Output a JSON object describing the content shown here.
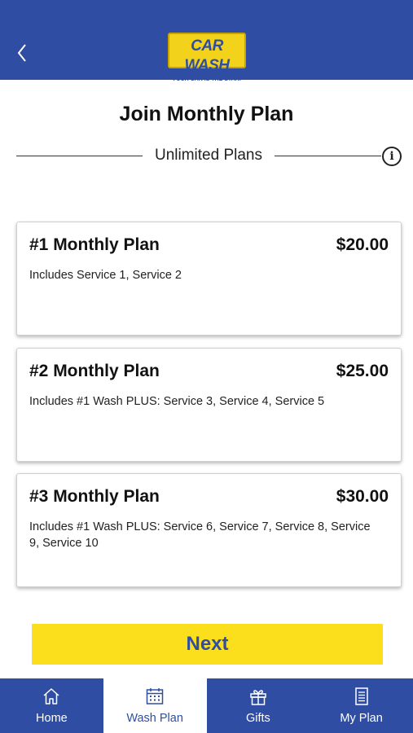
{
  "header": {
    "back_icon": "chevron-left-icon",
    "logo_text": "CAR WASH",
    "logo_tagline": "YOUR CAR IS THE STAR!",
    "bar_color": "#2f4ea3",
    "logo_color": "#f2d21b"
  },
  "page": {
    "title": "Join Monthly Plan",
    "section_label": "Unlimited Plans",
    "info_icon": "info-icon",
    "info_glyph": "i"
  },
  "plans": [
    {
      "name": "#1 Monthly Plan",
      "price": "$20.00",
      "description": "Includes Service 1, Service 2"
    },
    {
      "name": "#2 Monthly Plan",
      "price": "$25.00",
      "description": "Includes #1 Wash PLUS: Service 3, Service 4, Service 5"
    },
    {
      "name": "#3 Monthly Plan",
      "price": "$30.00",
      "description": "Includes #1 Wash PLUS: Service 6, Service 7, Service 8, Service 9, Service 10"
    }
  ],
  "actions": {
    "next_label": "Next",
    "next_color": "#fcdf1c"
  },
  "tabbar": {
    "tabs": [
      {
        "label": "Home",
        "icon": "home-icon",
        "active": false
      },
      {
        "label": "Wash Plan",
        "icon": "calendar-icon",
        "active": true
      },
      {
        "label": "Gifts",
        "icon": "gift-icon",
        "active": false
      },
      {
        "label": "My Plan",
        "icon": "document-icon",
        "active": false
      }
    ]
  }
}
